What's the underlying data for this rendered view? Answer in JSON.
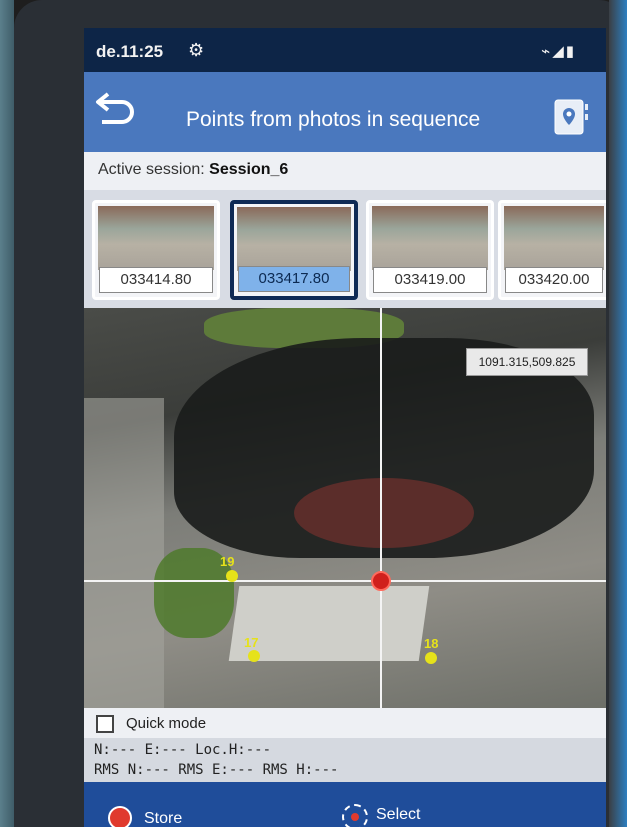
{
  "status_bar": {
    "time": "de.11:25"
  },
  "header": {
    "title": "Points from photos in sequence"
  },
  "session": {
    "label": "Active session:",
    "value": "Session_6"
  },
  "thumbnails": [
    {
      "label": "033414.80",
      "selected": false
    },
    {
      "label": "033417.80",
      "selected": true
    },
    {
      "label": "033419.00",
      "selected": false
    },
    {
      "label": "033420.00",
      "selected": false
    }
  ],
  "view": {
    "coordinate": "1091.315,509.825",
    "points": [
      {
        "label": "19"
      },
      {
        "label": "17"
      },
      {
        "label": "18"
      }
    ]
  },
  "quick_mode": {
    "label": "Quick mode",
    "checked": false
  },
  "readout": {
    "line1": "N:---  E:---  Loc.H:---",
    "line2": "RMS N:--- RMS E:--- RMS H:---"
  },
  "bottom": {
    "store_label": "Store",
    "select_label": "Select"
  },
  "colors": {
    "title_bar": "#4a78be",
    "bottom_bar": "#1f4d9a",
    "point": "#e6e21a",
    "crosshair": "#d0201c"
  }
}
